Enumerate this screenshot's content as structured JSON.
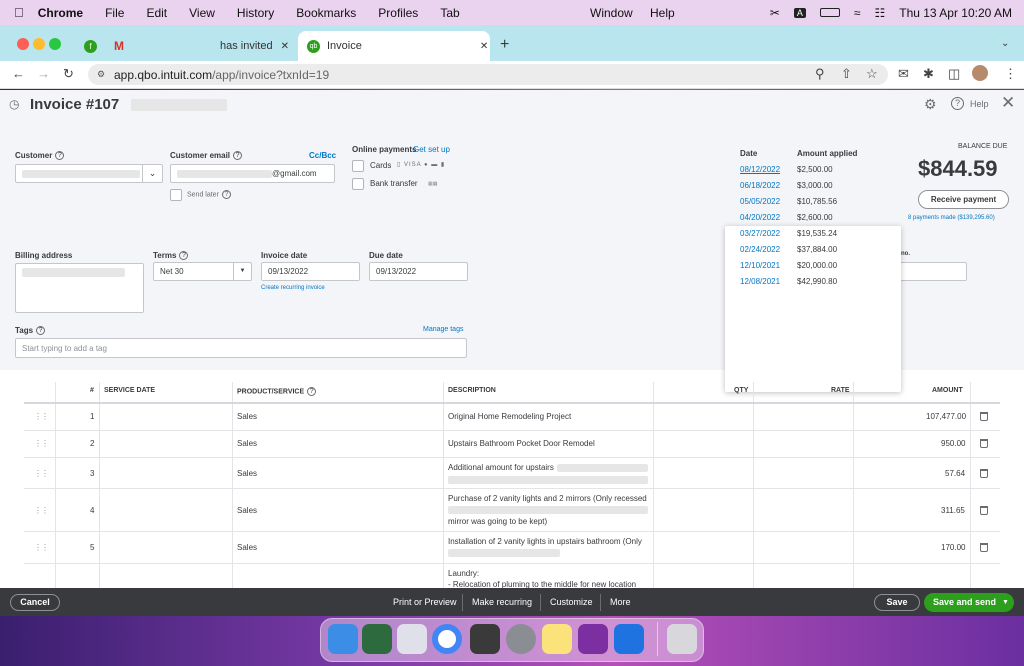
{
  "menubar": {
    "apple": "",
    "app": "Chrome",
    "items": [
      "File",
      "Edit",
      "View",
      "History",
      "Bookmarks",
      "Profiles",
      "Tab"
    ],
    "right_items": [
      "Window",
      "Help"
    ],
    "clock": "Thu 13 Apr  10:20 AM"
  },
  "browser": {
    "tabs": [
      {
        "label": "has invited",
        "icon": "gmail-icon"
      },
      {
        "label": "Invoice",
        "icon": "quickbooks-icon"
      }
    ],
    "url_host": "app.qbo.intuit.com",
    "url_path": "/app/invoice?txnId=19"
  },
  "invoice": {
    "title": "Invoice #107",
    "help": "Help",
    "customer_label": "Customer",
    "email_label": "Customer email",
    "ccbcc": "Cc/Bcc",
    "email_value": "@gmail.com",
    "send_later": "Send later",
    "online_payments": "Online payments",
    "get_set_up": "Get set up",
    "cards": "Cards",
    "bank_transfer": "Bank transfer",
    "billing_address": "Billing address",
    "terms_label": "Terms",
    "terms_value": "Net 30",
    "invoice_date_label": "Invoice date",
    "invoice_date": "09/13/2022",
    "due_date_label": "Due date",
    "due_date": "09/13/2022",
    "create_recurring": "Create recurring invoice",
    "tags_label": "Tags",
    "manage_tags": "Manage tags",
    "tags_placeholder": "Start typing to add a tag",
    "balance_due_label": "BALANCE DUE",
    "balance_due": "$844.59",
    "receive_payment": "Receive payment",
    "payments_made": "8 payments made ($139,295.60)",
    "no_label": "no."
  },
  "payments_popup": {
    "headers": [
      "Date",
      "Amount applied"
    ],
    "rows": [
      {
        "date": "08/12/2022",
        "amount": "$2,500.00"
      },
      {
        "date": "06/18/2022",
        "amount": "$3,000.00"
      },
      {
        "date": "05/05/2022",
        "amount": "$10,785.56"
      },
      {
        "date": "04/20/2022",
        "amount": "$2,600.00"
      },
      {
        "date": "03/27/2022",
        "amount": "$19,535.24"
      },
      {
        "date": "02/24/2022",
        "amount": "$37,884.00"
      },
      {
        "date": "12/10/2021",
        "amount": "$20,000.00"
      },
      {
        "date": "12/08/2021",
        "amount": "$42,990.80"
      }
    ]
  },
  "table": {
    "headers": {
      "num": "#",
      "service_date": "SERVICE DATE",
      "product": "PRODUCT/SERVICE",
      "description": "DESCRIPTION",
      "qty": "QTY",
      "rate": "RATE",
      "amount": "AMOUNT"
    },
    "rows": [
      {
        "num": "1",
        "product": "Sales",
        "desc1": "Original Home Remodeling Project",
        "desc2": "",
        "amount": "107,477.00"
      },
      {
        "num": "2",
        "product": "Sales",
        "desc1": "Upstairs Bathroom Pocket Door Remodel",
        "desc2": "",
        "amount": "950.00"
      },
      {
        "num": "3",
        "product": "Sales",
        "desc1": "Additional amount for upstairs",
        "desc2": "",
        "amount": "57.64"
      },
      {
        "num": "4",
        "product": "Sales",
        "desc1": "Purchase of 2 vanity lights and 2 mirrors (Only recessed",
        "desc2": "mirror was going to be kept)",
        "amount": "311.65"
      },
      {
        "num": "5",
        "product": "Sales",
        "desc1": "Installation of 2 vanity lights in upstairs bathroom (Only",
        "desc2": "",
        "amount": "170.00"
      },
      {
        "num": "",
        "product": "",
        "desc1": "Laundry:",
        "desc2": "- Relocation of pluming to the middle for new location",
        "amount": ""
      }
    ]
  },
  "footer": {
    "cancel": "Cancel",
    "print_preview": "Print or Preview",
    "make_recurring": "Make recurring",
    "customize": "Customize",
    "more": "More",
    "save": "Save",
    "save_and_send": "Save and send"
  },
  "colors": {
    "accent": "#2ca01c",
    "link": "#0077c5",
    "footer": "#393a3d"
  }
}
